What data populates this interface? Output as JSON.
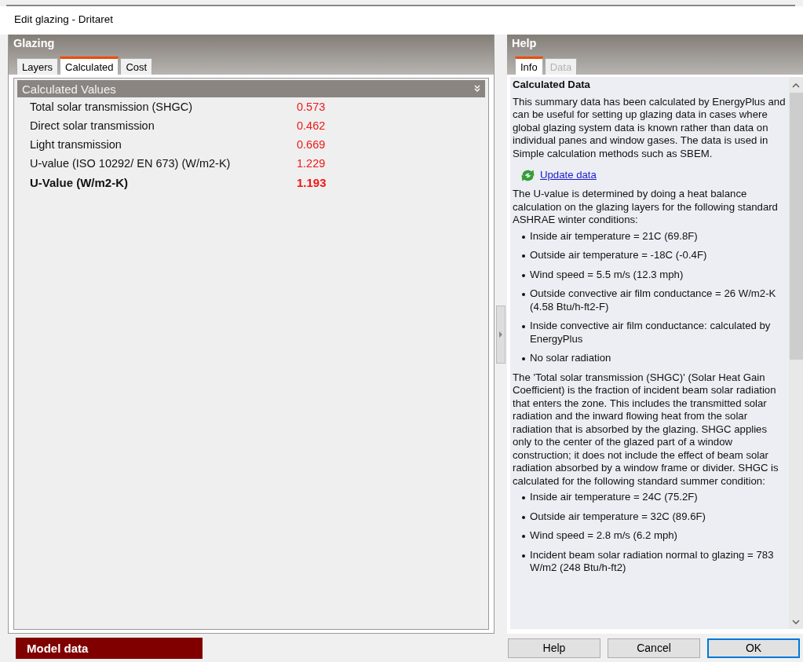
{
  "window": {
    "title": "Edit glazing - Dritaret"
  },
  "glazing": {
    "title": "Glazing",
    "tabs": [
      {
        "label": "Layers",
        "selected": false
      },
      {
        "label": "Calculated",
        "selected": true
      },
      {
        "label": "Cost",
        "selected": false
      }
    ],
    "section": {
      "title": "Calculated Values",
      "expanded": true
    },
    "rows": [
      {
        "kind": "normal",
        "label": "Total solar transmission (SHGC)",
        "value": "0.573"
      },
      {
        "kind": "normal",
        "label": "Direct solar transmission",
        "value": "0.462"
      },
      {
        "kind": "normal",
        "label": "Light transmission",
        "value": "0.669"
      },
      {
        "kind": "normal",
        "label": "U-value (ISO 10292/ EN 673) (W/m2-K)",
        "value": "1.229"
      },
      {
        "kind": "total",
        "label": "U-Value (W/m2-K)",
        "value": "1.193"
      }
    ]
  },
  "help": {
    "title": "Help",
    "tabs": [
      {
        "label": "Info",
        "selected": true,
        "disabled": false
      },
      {
        "label": "Data",
        "selected": false,
        "disabled": true
      }
    ],
    "blocks": [
      {
        "kind": "heading",
        "text": "Calculated Data"
      },
      {
        "kind": "paragraph",
        "text": "This summary data has been calculated by EnergyPlus and can be useful for setting up glazing data in cases where global glazing system data is known rather than data on individual panes and window gases. The data is used in Simple calculation methods such as SBEM."
      },
      {
        "kind": "link",
        "text": "Update data"
      },
      {
        "kind": "paragraph",
        "text": "The U-value is determined by doing a heat balance calculation on the glazing layers for the following standard ASHRAE winter conditions:"
      },
      {
        "kind": "bullets",
        "items": [
          "Inside air temperature = 21C (69.8F)",
          "Outside air temperature = -18C (-0.4F)",
          "Wind speed = 5.5 m/s (12.3 mph)",
          "Outside convective air film conductance = 26 W/m2-K (4.58 Btu/h-ft2-F)",
          "Inside convective air film conductance: calculated by EnergyPlus",
          "No solar radiation"
        ]
      },
      {
        "kind": "paragraph",
        "text": "The 'Total solar transmission (SHGC)' (Solar Heat Gain Coefficient) is the fraction of incident beam solar radiation that enters the zone. This includes the transmitted solar radiation and the inward flowing heat from the solar radiation that is absorbed by the glazing. SHGC applies only to the center of the glazed part of a window construction; it does not include the effect of beam solar radiation absorbed by a window frame or divider. SHGC is calculated for the following standard summer condition:"
      },
      {
        "kind": "bullets",
        "items": [
          "Inside air temperature = 24C (75.2F)",
          "Outside air temperature = 32C (89.6F)",
          "Wind speed = 2.8 m/s (6.2 mph)",
          "Incident beam solar radiation normal to glazing = 783 W/m2 (248 Btu/h-ft2)"
        ]
      }
    ]
  },
  "footer": {
    "model_data": "Model data",
    "buttons": [
      "Help",
      "Cancel",
      "OK"
    ]
  }
}
